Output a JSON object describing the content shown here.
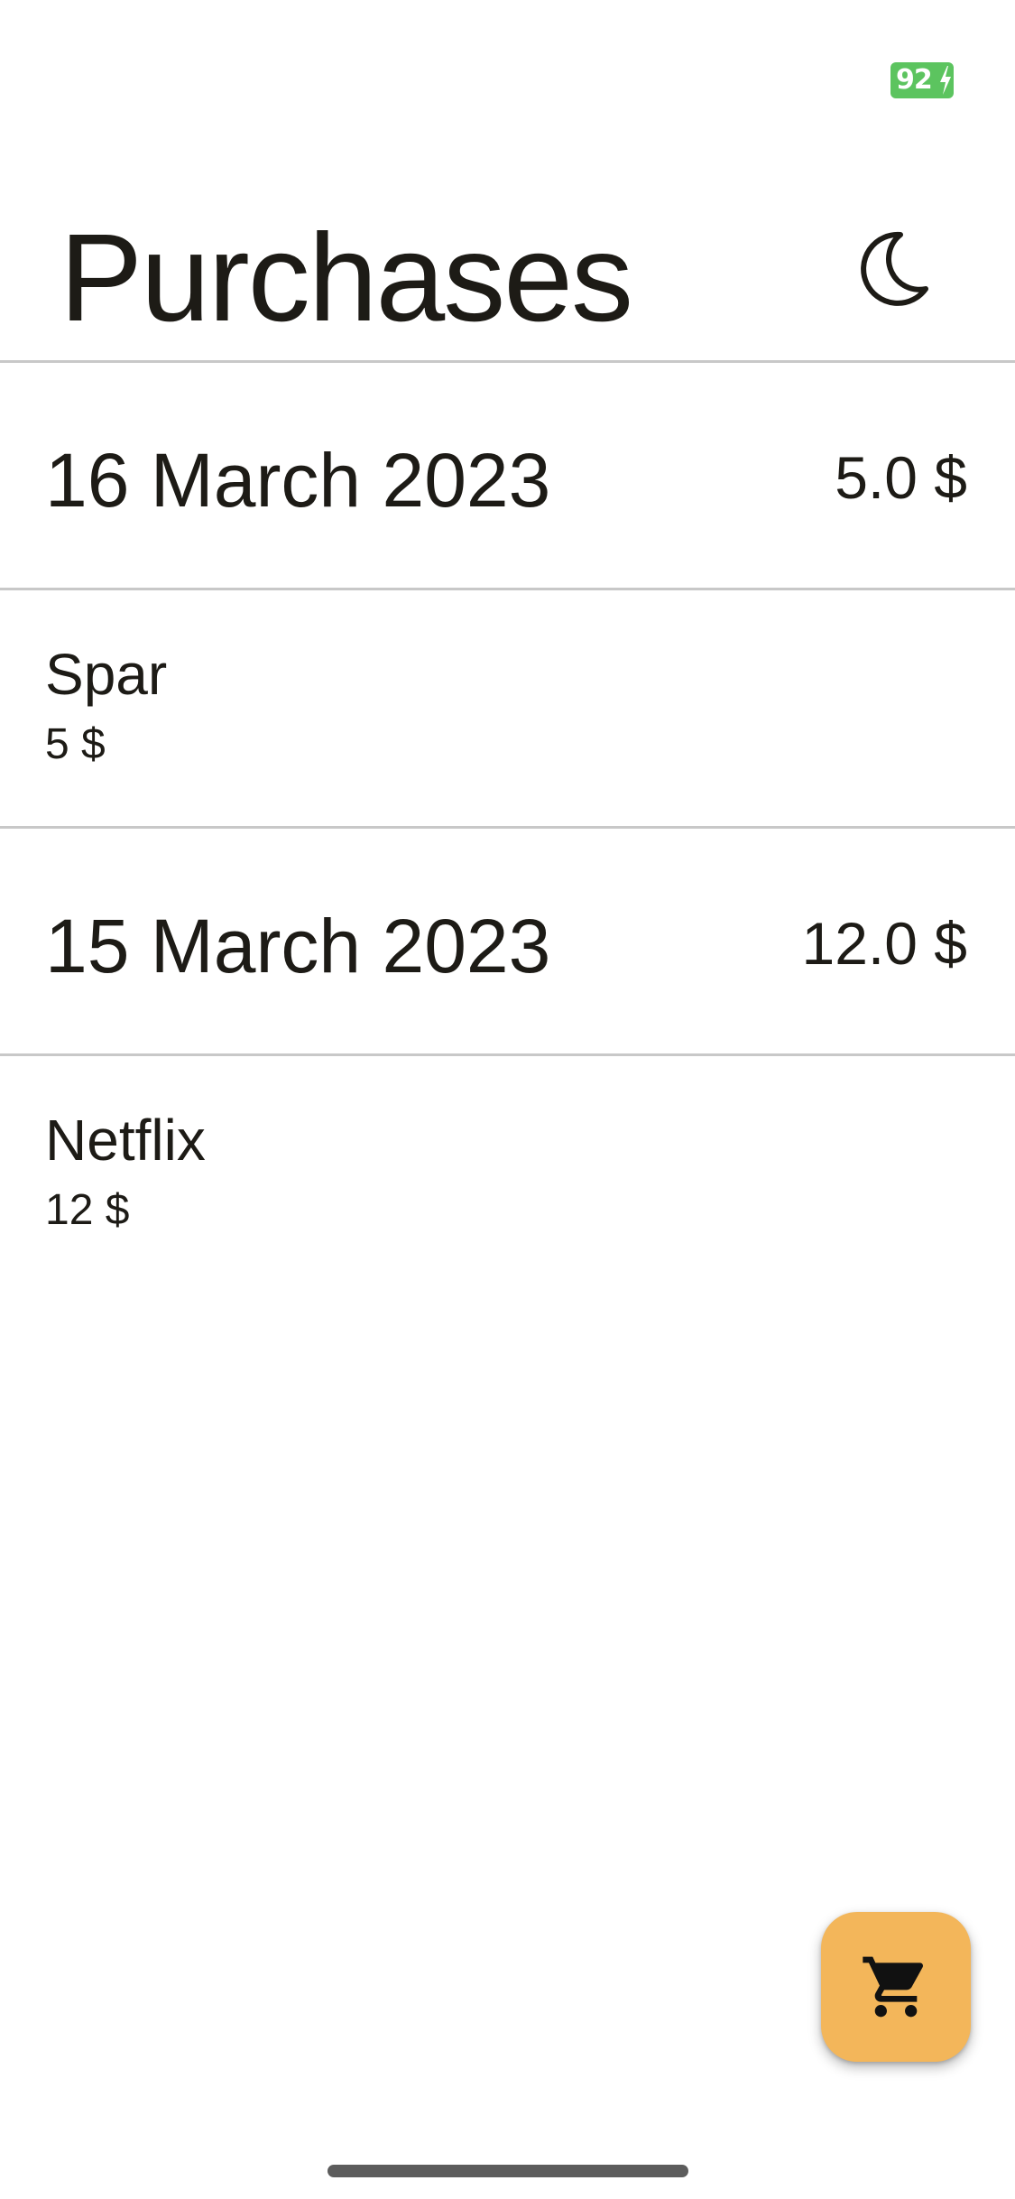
{
  "status_bar": {
    "battery_level": "92",
    "battery_charging": true,
    "battery_color": "#5cc45f"
  },
  "header": {
    "title": "Purchases",
    "theme_toggle_icon": "crescent-moon-icon"
  },
  "groups": [
    {
      "date": "16 March 2023",
      "total": "5.0 $",
      "items": [
        {
          "name": "Spar",
          "amount": "5 $"
        }
      ]
    },
    {
      "date": "15 March 2023",
      "total": "12.0 $",
      "items": [
        {
          "name": "Netflix",
          "amount": "12 $"
        }
      ]
    }
  ],
  "fab": {
    "icon": "shopping-cart-icon",
    "color": "#f3b65a"
  }
}
